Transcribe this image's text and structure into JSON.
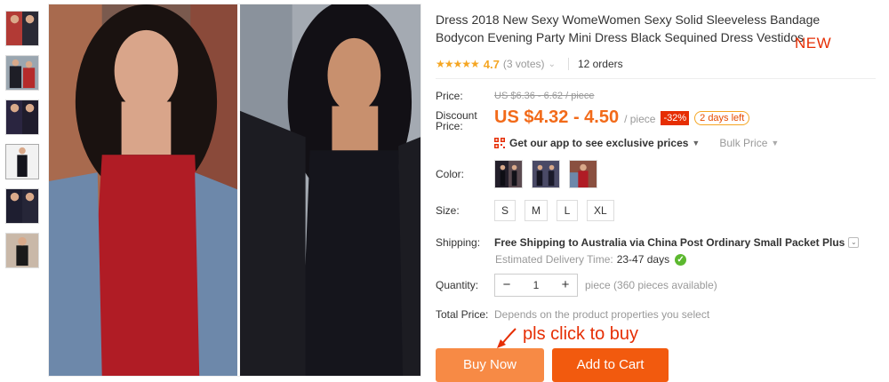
{
  "product": {
    "title": "Dress 2018 New Sexy WomeWomen Sexy Solid Sleeveless Bandage Bodycon Evening Party Mini Dress Black Sequined Dress Vestidos",
    "new_badge": "NEW",
    "stars": "★★★★★",
    "rating": "4.7",
    "votes": "(3 votes)",
    "orders": "12 orders"
  },
  "price": {
    "label": "Price:",
    "original": "US $6.36 - 6.62 / piece",
    "discount_label": "Discount Price:",
    "discount": "US $4.32 - 4.50",
    "per": "/ piece",
    "off": "-32%",
    "days_left": "2 days left",
    "app_link": "Get our app to see exclusive prices",
    "bulk": "Bulk Price"
  },
  "options": {
    "color_label": "Color:",
    "size_label": "Size:",
    "sizes": [
      "S",
      "M",
      "L",
      "XL"
    ]
  },
  "shipping": {
    "label": "Shipping:",
    "main": "Free Shipping to Australia via China Post Ordinary Small Packet Plus",
    "est_label": "Estimated Delivery Time:",
    "days": "23-47 days"
  },
  "quantity": {
    "label": "Quantity:",
    "minus": "−",
    "value": "1",
    "plus": "+",
    "available": "piece (360 pieces available)"
  },
  "total": {
    "label": "Total Price:",
    "value": "Depends on the product properties you select"
  },
  "annotation": "pls click to buy",
  "buttons": {
    "buy_now": "Buy Now",
    "add_to_cart": "Add to Cart"
  },
  "colors": {
    "accent": "#f26a19",
    "red": "#e62e04",
    "buy_now_bg": "#f78a45",
    "add_to_cart_bg": "#f25a0e"
  }
}
